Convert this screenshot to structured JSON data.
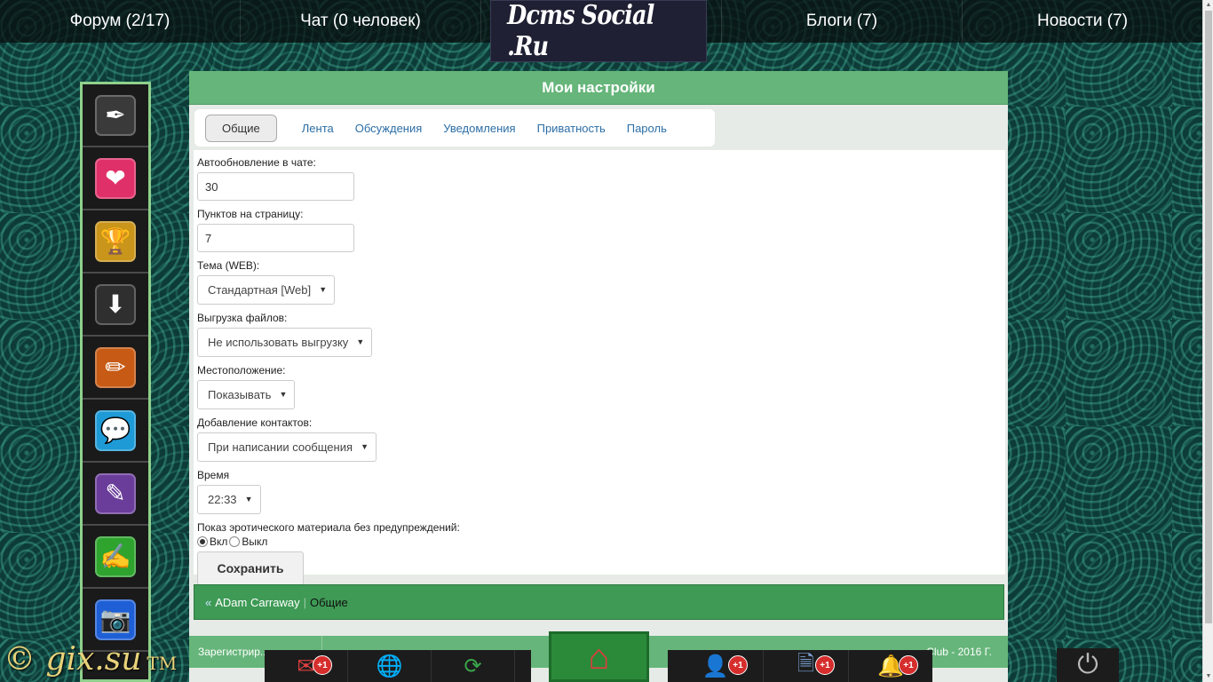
{
  "topnav": {
    "forum": "Форум (2/17)",
    "chat": "Чат (0 человек)",
    "logo": "Dcms Social .Ru",
    "blogs": "Блоги (7)",
    "news": "Новости (7)"
  },
  "sidebar": [
    {
      "icon": "pen-icon",
      "glyph": "✒",
      "color": "#3a3a3a"
    },
    {
      "icon": "heart-icon",
      "glyph": "❤",
      "color": "#e0306a"
    },
    {
      "icon": "trophy-icon",
      "glyph": "🏆",
      "color": "#c9951a"
    },
    {
      "icon": "download-icon",
      "glyph": "⬇",
      "color": "#2f2f2f"
    },
    {
      "icon": "pencil-icon",
      "glyph": "✏",
      "color": "#c75a14"
    },
    {
      "icon": "chat-icon",
      "glyph": "💬",
      "color": "#1e9ad6"
    },
    {
      "icon": "edit-icon",
      "glyph": "✎",
      "color": "#6a3d9a"
    },
    {
      "icon": "notes-icon",
      "glyph": "✍",
      "color": "#2ea32e"
    },
    {
      "icon": "camera-icon",
      "glyph": "📷",
      "color": "#1e5fd6"
    }
  ],
  "panel": {
    "title": "Мои настройки",
    "tabs": [
      "Общие",
      "Лента",
      "Обсуждения",
      "Уведомления",
      "Приватность",
      "Пароль"
    ]
  },
  "form": {
    "chat_refresh_label": "Автообновление в чате:",
    "chat_refresh_value": "30",
    "per_page_label": "Пунктов на страницу:",
    "per_page_value": "7",
    "theme_label": "Тема (WEB):",
    "theme_value": "Стандартная [Web]",
    "upload_label": "Выгрузка файлов:",
    "upload_value": "Не использовать выгрузку",
    "location_label": "Местоположение:",
    "location_value": "Показывать",
    "contacts_label": "Добавление контактов:",
    "contacts_value": "При написании сообщения",
    "time_label": "Время",
    "time_value": "22:33",
    "erotic_label": "Показ эротического материала без предупреждений:",
    "radio_on": "Вкл",
    "radio_off": "Выкл",
    "save": "Сохранить"
  },
  "breadcrumb": {
    "back": "«",
    "user": "ADam Carraway",
    "current": "Общие"
  },
  "footer": {
    "left": "Зарегистрир...",
    "right": "...Club - 2016 Г."
  },
  "dock": {
    "mail_badge": "+1",
    "friends_badge": "+1",
    "notes_badge": "+1",
    "bell_badge": "+1"
  },
  "watermark": {
    "text": "© gix.su",
    "tm": "TM"
  },
  "colors": {
    "accent": "#66b57a",
    "breadcrumb_bg": "#3e9a55",
    "badge": "#d62d2d"
  }
}
